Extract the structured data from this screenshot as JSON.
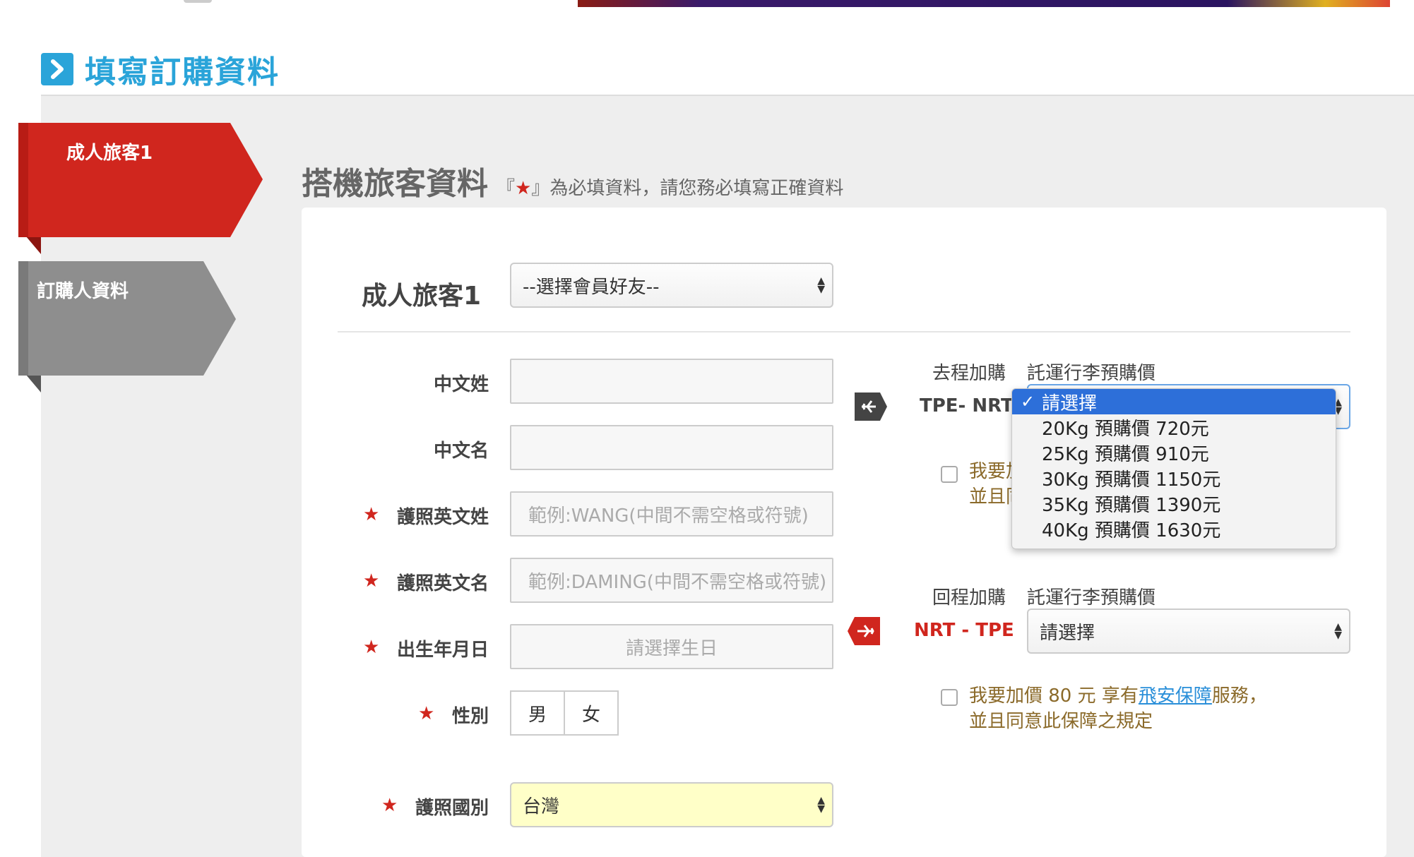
{
  "page": {
    "title": "填寫訂購資料"
  },
  "tabs": [
    {
      "label": "成人旅客1",
      "active": true
    },
    {
      "label": "訂購人資料",
      "active": false
    }
  ],
  "section": {
    "title": "搭機旅客資料",
    "note_prefix": "『",
    "note_star": "★",
    "note_suffix": "』為必填資料，請您務必填寫正確資料"
  },
  "traveler": {
    "heading": "成人旅客1",
    "member_select": "--選擇會員好友--"
  },
  "fields": {
    "cn_last": {
      "label": "中文姓",
      "value": ""
    },
    "cn_first": {
      "label": "中文名",
      "value": ""
    },
    "en_last": {
      "label": "護照英文姓",
      "placeholder": "範例:WANG(中間不需空格或符號)"
    },
    "en_first": {
      "label": "護照英文名",
      "placeholder": "範例:DAMING(中間不需空格或符號)"
    },
    "birthday": {
      "label": "出生年月日",
      "placeholder": "請選擇生日"
    },
    "gender": {
      "label": "性別",
      "options": [
        "男",
        "女"
      ]
    },
    "nationality": {
      "label": "護照國別",
      "value": "台灣"
    }
  },
  "required_star": "★",
  "outbound": {
    "label": "去程加購",
    "baggage_label": "託運行李預購價",
    "route": "TPE- NRT",
    "insurance_line1": "我要加",
    "insurance_line2": "並且同",
    "dropdown_options": [
      "請選擇",
      "20Kg 預購價 720元",
      "25Kg 預購價 910元",
      "30Kg 預購價 1150元",
      "35Kg 預購價 1390元",
      "40Kg 預購價 1630元"
    ],
    "dropdown_selected_index": 0
  },
  "return": {
    "label": "回程加購",
    "baggage_label": "託運行李預購價",
    "route": "NRT - TPE",
    "select_value": "請選擇",
    "insurance_pre": "我要加價 80 元 享有",
    "insurance_link": "飛安保障",
    "insurance_post": "服務，",
    "insurance_line2": "並且同意此保障之規定"
  },
  "colors": {
    "accent_blue": "#2aa4d9",
    "active_tab": "#d0261e",
    "inactive_tab": "#8e8e8e",
    "required": "#d0261e",
    "dropdown_highlight": "#2d6fd9"
  },
  "icons": {
    "header": "chevron-right-icon",
    "outbound": "plane-departure-icon",
    "return": "plane-arrival-icon",
    "select_arrows": "up-down-arrows-icon",
    "checkmark": "checkmark-icon"
  }
}
